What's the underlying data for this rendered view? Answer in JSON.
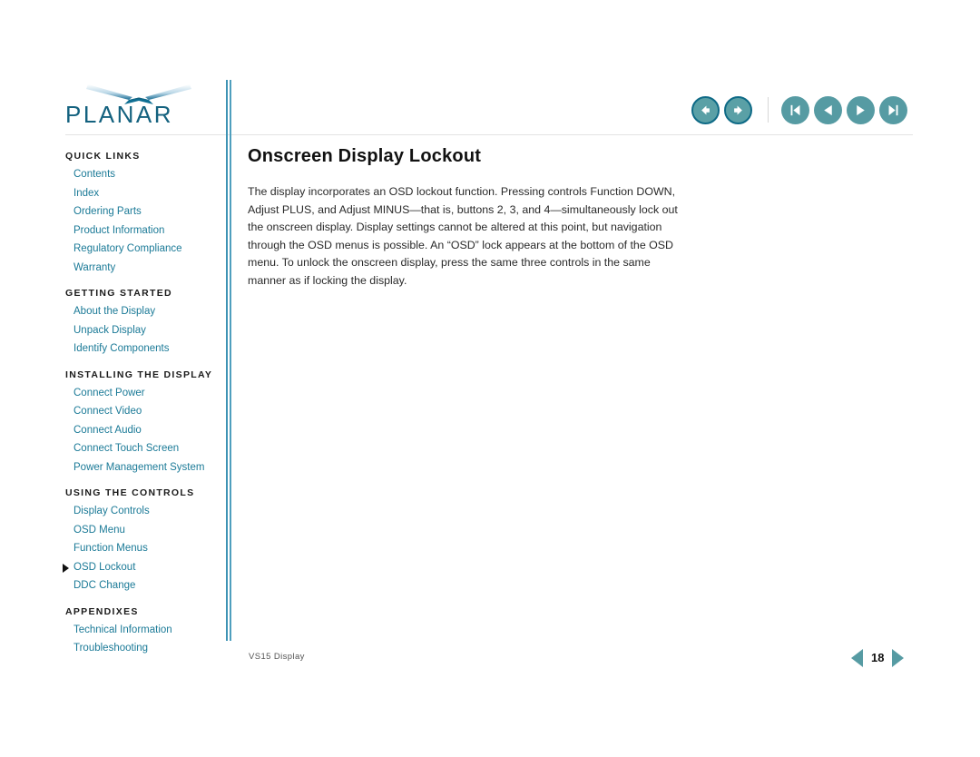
{
  "brand": {
    "name": "PLANAR",
    "logo_mark": "planar-swoosh-icon",
    "mark_color": "#0f6f93",
    "wordmark_color": "#14627f"
  },
  "topnav": {
    "buttons": [
      {
        "name": "back-button",
        "icon": "arrow-left-icon",
        "style": "ringed"
      },
      {
        "name": "forward-button",
        "icon": "arrow-right-icon",
        "style": "ringed"
      },
      {
        "name": "first-page-button",
        "icon": "skip-to-start-icon",
        "style": "plain"
      },
      {
        "name": "previous-page-button",
        "icon": "triangle-left-icon",
        "style": "plain"
      },
      {
        "name": "next-page-button",
        "icon": "triangle-right-icon",
        "style": "plain"
      },
      {
        "name": "last-page-button",
        "icon": "skip-to-end-icon",
        "style": "plain"
      }
    ],
    "accent_color": "#569ba3",
    "ring_color": "#0e6a86"
  },
  "sidebar": {
    "sections": [
      {
        "heading": "QUICK LINKS",
        "items": [
          {
            "label": "Contents",
            "active": false
          },
          {
            "label": "Index",
            "active": false
          },
          {
            "label": "Ordering Parts",
            "active": false
          },
          {
            "label": "Product Information",
            "active": false
          },
          {
            "label": "Regulatory Compliance",
            "active": false
          },
          {
            "label": "Warranty",
            "active": false
          }
        ]
      },
      {
        "heading": "GETTING STARTED",
        "items": [
          {
            "label": "About the Display",
            "active": false
          },
          {
            "label": "Unpack Display",
            "active": false
          },
          {
            "label": "Identify Components",
            "active": false
          }
        ]
      },
      {
        "heading": "INSTALLING THE DISPLAY",
        "items": [
          {
            "label": "Connect Power",
            "active": false
          },
          {
            "label": "Connect Video",
            "active": false
          },
          {
            "label": "Connect Audio",
            "active": false
          },
          {
            "label": "Connect Touch Screen",
            "active": false
          },
          {
            "label": "Power Management System",
            "active": false
          }
        ]
      },
      {
        "heading": "USING THE CONTROLS",
        "items": [
          {
            "label": "Display Controls",
            "active": false
          },
          {
            "label": "OSD Menu",
            "active": false
          },
          {
            "label": "Function Menus",
            "active": false
          },
          {
            "label": "OSD Lockout",
            "active": true
          },
          {
            "label": "DDC Change",
            "active": false
          }
        ]
      },
      {
        "heading": "APPENDIXES",
        "items": [
          {
            "label": "Technical Information",
            "active": false
          },
          {
            "label": "Troubleshooting",
            "active": false
          }
        ]
      }
    ],
    "link_color": "#1b7a97",
    "heading_color": "#1a1a1a"
  },
  "main": {
    "title": "Onscreen Display Lockout",
    "body": "The display incorporates an OSD lockout function. Pressing controls Function DOWN, Adjust PLUS, and Adjust MINUS—that is, buttons 2, 3, and 4—simultaneously lock out the onscreen display. Display settings cannot be altered at this point, but navigation through the OSD menus is possible. An “OSD” lock appears at the bottom of the OSD menu. To unlock the onscreen display, press the same three controls in the same manner as if locking the display."
  },
  "footer": {
    "document_label": "VS15 Display",
    "page_number": "18",
    "prev_icon": "triangle-left-icon",
    "next_icon": "triangle-right-icon"
  }
}
